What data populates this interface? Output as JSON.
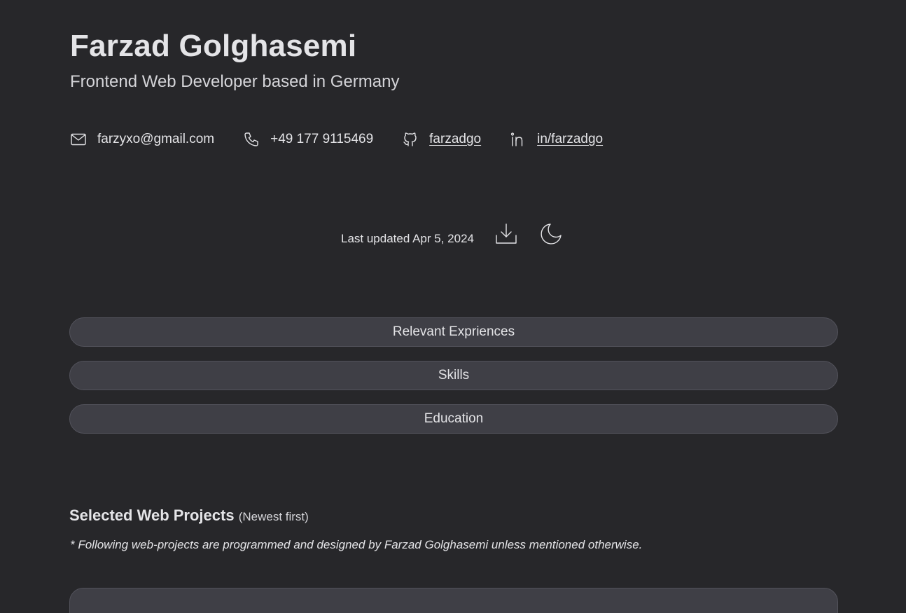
{
  "header": {
    "name": "Farzad Golghasemi",
    "subtitle": "Frontend Web Developer based in Germany"
  },
  "contacts": [
    {
      "icon": "mail-icon",
      "text": "farzyxo@gmail.com"
    },
    {
      "icon": "phone-icon",
      "text": "+49 177 9115469"
    },
    {
      "icon": "github-icon",
      "text": "farzadgo"
    },
    {
      "icon": "linkedin-icon",
      "text": "in/farzadgo"
    }
  ],
  "meta": {
    "last_updated": "Last updated Apr 5, 2024",
    "download_icon": "download-icon",
    "theme_icon": "moon-icon"
  },
  "sections": [
    {
      "label": "Relevant Expriences"
    },
    {
      "label": "Skills"
    },
    {
      "label": "Education"
    }
  ],
  "projects": {
    "heading": "Selected Web Projects",
    "note": "(Newest first)",
    "disclaimer": "* Following web-projects are programmed and designed by Farzad Golghasemi unless mentioned otherwise."
  },
  "colors": {
    "background": "#27272a",
    "surface": "#3f3f46",
    "border": "#52525b",
    "text": "#e4e4e7"
  }
}
